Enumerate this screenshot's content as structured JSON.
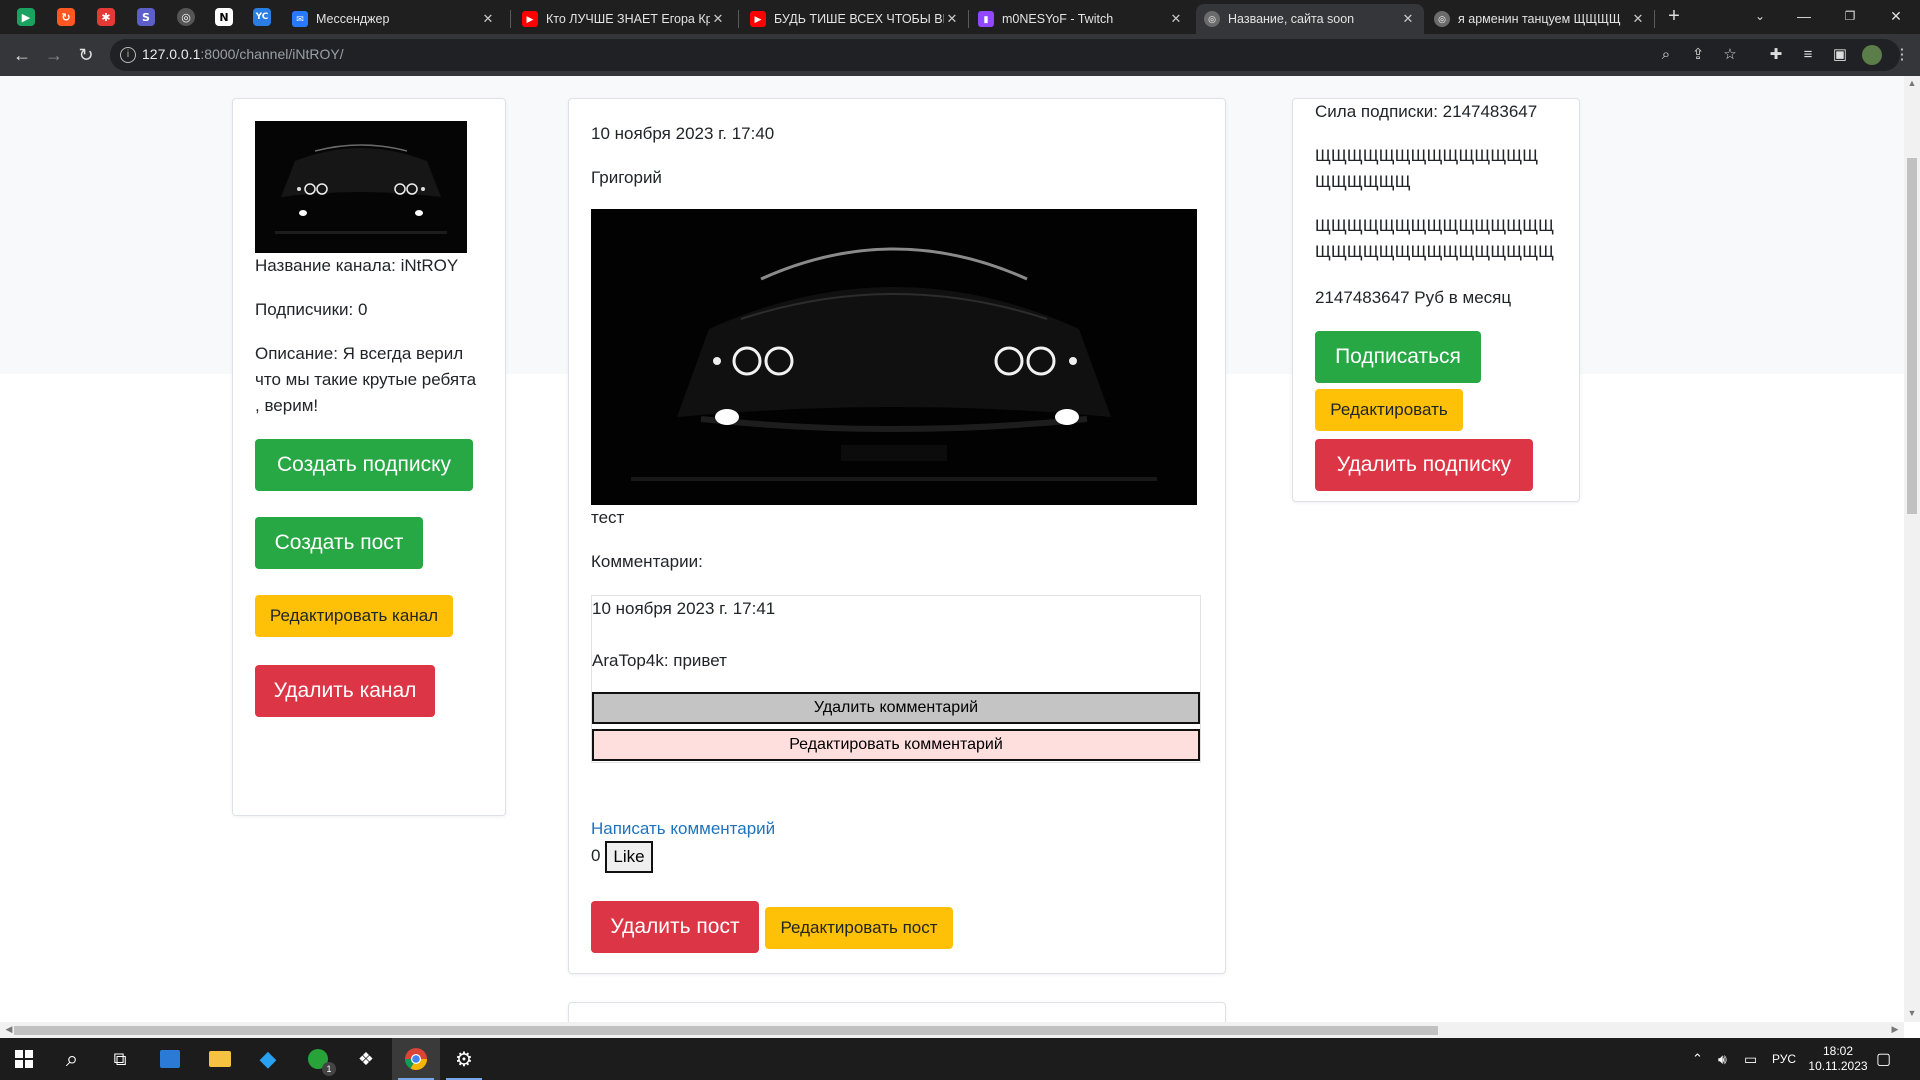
{
  "browser": {
    "pinned_tabs": [
      {
        "icon": "play-store-icon",
        "color": "#1aa260"
      },
      {
        "icon": "refresh-orange-icon",
        "color": "#ff5722"
      },
      {
        "icon": "star-red-icon",
        "color": "#e53935"
      },
      {
        "icon": "s-purple-icon",
        "color": "#5b5fc7"
      },
      {
        "icon": "globe-icon",
        "color": "#444444"
      },
      {
        "icon": "notion-icon",
        "color": "#333333"
      },
      {
        "icon": "yc-icon",
        "color": "#2a7de1"
      }
    ],
    "tabs": [
      {
        "title": "Мессенджер",
        "icon": "messenger-icon",
        "color": "#2979ff"
      },
      {
        "title": "Кто ЛУЧШЕ ЗНАЕТ Егора Кри",
        "icon": "youtube-icon",
        "color": "#ff0000"
      },
      {
        "title": "БУДЬ ТИШЕ ВСЕХ ЧТОБЫ ВЫ",
        "icon": "youtube-icon",
        "color": "#ff0000"
      },
      {
        "title": "m0NESYoF - Twitch",
        "icon": "twitch-icon",
        "color": "#9146ff"
      },
      {
        "title": "Название, сайта soon",
        "icon": "globe-icon",
        "color": "#777777",
        "active": true
      },
      {
        "title": "я арменин танцуем ЩЩЩЩ",
        "icon": "globe-icon",
        "color": "#777777"
      }
    ],
    "new_tab": "+",
    "url_host": "127.0.0.1",
    "url_rest": ":8000/channel/iNtROY/"
  },
  "channel": {
    "name_label": "Название канала: iNtROY",
    "subscribers_label": "Подписчики: 0",
    "description_label": "Описание: Я всегда верил что мы такие крутые ребята , верим!",
    "create_subscription": "Создать подписку",
    "create_post": "Создать пост",
    "edit_channel": "Редактировать канал",
    "delete_channel": "Удалить канал"
  },
  "post": {
    "date": "10 ноября 2023 г. 17:40",
    "author": "Григорий",
    "text": "тест",
    "comments_header": "Комментарии:",
    "comment": {
      "date": "10 ноября 2023 г. 17:41",
      "text": "AraTop4k: привет",
      "delete": "Удалить комментарий",
      "edit": "Редактировать комментарий"
    },
    "write_comment": "Написать комментарий",
    "likes": "0",
    "like_button": "Like",
    "delete_post": "Удалить пост",
    "edit_post": "Редактировать пост"
  },
  "subscription": {
    "power": "Сила подписки: 2147483647",
    "title": "ЩЩЩЩЩЩЩЩЩЩЩЩЩЩЩЩЩЩЩЩ",
    "description": "ЩЩЩЩЩЩЩЩЩЩЩЩЩЩЩЩЩЩЩЩЩЩЩЩЩЩЩЩЩЩЩЩЩЩЩЩЩ...",
    "price": "2147483647 Руб в месяц",
    "subscribe": "Подписаться",
    "edit": "Редактировать",
    "delete": "Удалить подписку"
  },
  "taskbar": {
    "lang": "РУС",
    "time": "18:02",
    "date": "10.11.2023",
    "badge": "1"
  },
  "colors": {
    "success": "#28a745",
    "danger": "#dc3545",
    "warning": "#ffc107",
    "link": "#1e73be"
  }
}
